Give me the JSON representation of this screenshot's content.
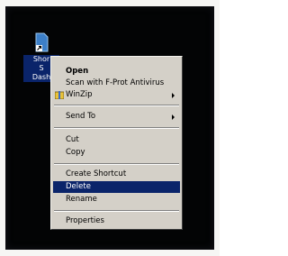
{
  "desktop_icon": {
    "label_lines": [
      "Shor",
      "S",
      "Dash"
    ]
  },
  "context_menu": {
    "items": [
      {
        "label": "Open"
      },
      {
        "label": "Scan with F-Prot Antivirus"
      },
      {
        "label": "WinZip"
      },
      {
        "label": "Send To"
      },
      {
        "label": "Cut"
      },
      {
        "label": "Copy"
      },
      {
        "label": "Create Shortcut"
      },
      {
        "label": "Delete"
      },
      {
        "label": "Rename"
      },
      {
        "label": "Properties"
      }
    ],
    "selected": "Delete"
  },
  "colors": {
    "desktop": "#030405",
    "menu_face": "#d4d0c8",
    "highlight": "#0a246a",
    "highlight_text": "#ffffff"
  },
  "icons": [
    "shortcut-file-icon",
    "winzip-icon",
    "submenu-arrow-icon"
  ]
}
